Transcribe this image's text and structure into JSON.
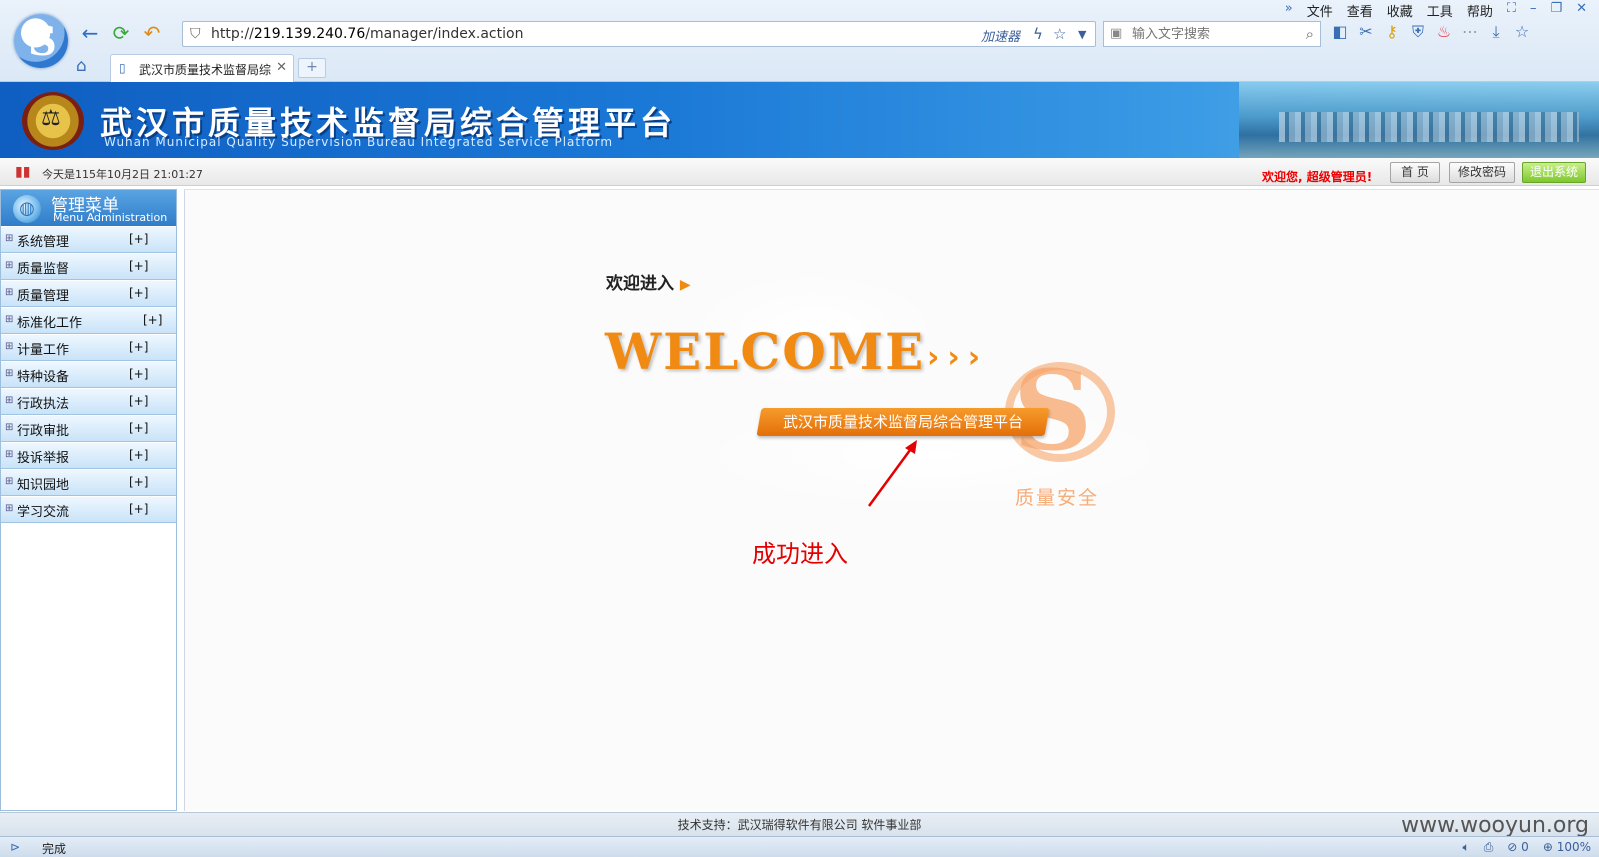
{
  "browser": {
    "url_prefix": "http://",
    "url_host": "219.139.240.76",
    "url_path": "/manager/index.action",
    "accelerator": "加速器",
    "search_placeholder": "输入文字搜索",
    "menu": [
      "文件",
      "查看",
      "收藏",
      "工具",
      "帮助"
    ],
    "tab_title": "武汉市质量技术监督局综",
    "new_tab": "+"
  },
  "banner": {
    "title": "武汉市质量技术监督局综合管理平台",
    "subtitle": "Wuhan Municipal Quality Supervision Bureau Integrated Service Platform"
  },
  "infobar": {
    "date": "今天是115年10月2日  21:01:27",
    "welcome": "欢迎您, 超级管理员!",
    "home_label": "首 页",
    "change_pwd_label": "修改密码",
    "exit_label": "退出系统"
  },
  "sidebar": {
    "title": "管理菜单",
    "subtitle": "Menu Administration",
    "items": [
      {
        "label": "系统管理",
        "toggle": "[+]"
      },
      {
        "label": "质量监督",
        "toggle": "[+]"
      },
      {
        "label": "质量管理",
        "toggle": "[+]"
      },
      {
        "label": "标准化工作",
        "toggle": "[+]"
      },
      {
        "label": "计量工作",
        "toggle": "[+]"
      },
      {
        "label": "特种设备",
        "toggle": "[+]"
      },
      {
        "label": "行政执法",
        "toggle": "[+]"
      },
      {
        "label": "行政审批",
        "toggle": "[+]"
      },
      {
        "label": "投诉举报",
        "toggle": "[+]"
      },
      {
        "label": "知识园地",
        "toggle": "[+]"
      },
      {
        "label": "学习交流",
        "toggle": "[+]"
      }
    ]
  },
  "main": {
    "welcome_in": "欢迎进入",
    "welcome_big": "WELCOME",
    "chevrons": "›››",
    "ribbon": "武汉市质量技术监督局综合管理平台",
    "logo_letter": "S",
    "logo_text": "质量安全",
    "annotation": "成功进入"
  },
  "footer": {
    "support": "技术支持：武汉瑞得软件有限公司  软件事业部",
    "watermark": "www.wooyun.org"
  },
  "status": {
    "text": "完成",
    "count": "0",
    "zoom": "100%"
  },
  "colors": {
    "accent_orange": "#f08a12",
    "banner_blue": "#1a78d6",
    "alert_red": "#e40000"
  }
}
